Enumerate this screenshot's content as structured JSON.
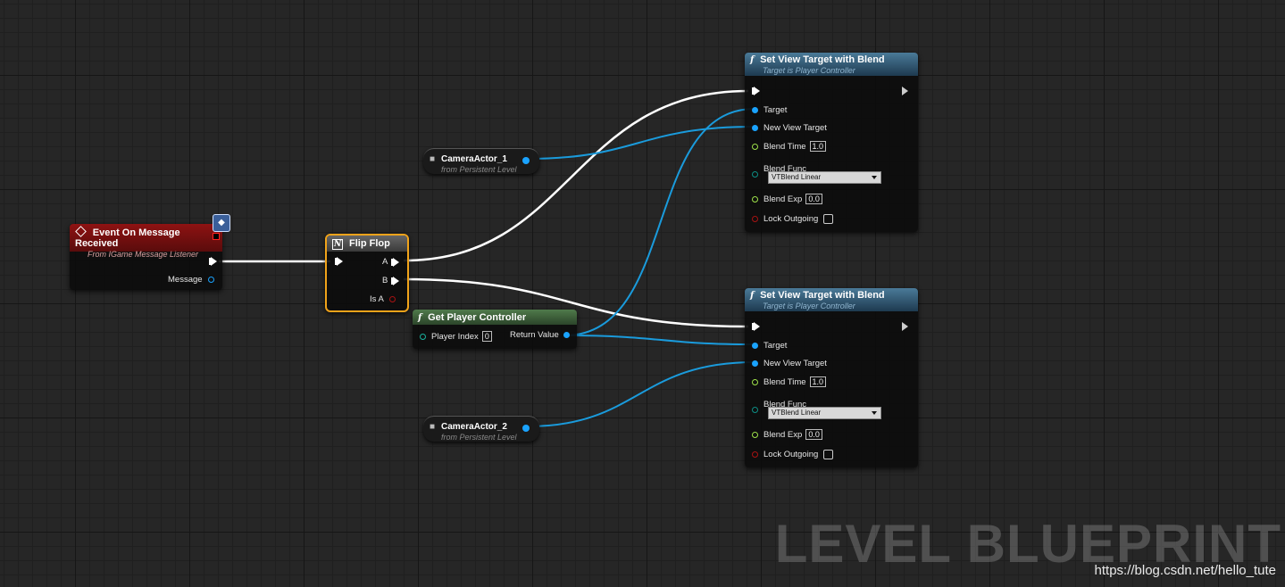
{
  "graph": {
    "watermark": "LEVEL BLUEPRINT",
    "credit": "https://blog.csdn.net/hello_tute"
  },
  "colors": {
    "event_header": "#8e1212",
    "function_header": "#2c5a78",
    "pure_function_header": "#3b5a3a",
    "flipflop_header": "#555555",
    "selection_outline": "#f0a31a",
    "exec_wire": "#ffffff",
    "object_wire": "#1a9bdc"
  },
  "nodes": {
    "event": {
      "title": "Event On Message Received",
      "subtitle": "From IGame Message Listener",
      "icon": "diamond-event-icon",
      "badge_icon": "interface-badge-icon",
      "message_label": "Message"
    },
    "flipflop": {
      "title": "Flip Flop",
      "icon": "macro-icon",
      "pin_a": "A",
      "pin_b": "B",
      "pin_isa": "Is A"
    },
    "camera1": {
      "title": "CameraActor_1",
      "subtitle": "from Persistent Level",
      "icon": "camera-icon"
    },
    "camera2": {
      "title": "CameraActor_2",
      "subtitle": "from Persistent Level",
      "icon": "camera-icon"
    },
    "getpc": {
      "title": "Get Player Controller",
      "icon": "function-icon",
      "player_index_label": "Player Index",
      "player_index_value": "0",
      "return_label": "Return Value"
    },
    "svt1": {
      "title": "Set View Target with Blend",
      "subtitle": "Target is Player Controller",
      "icon": "function-icon",
      "target": "Target",
      "new_view_target": "New View Target",
      "blend_time": "Blend Time",
      "blend_time_value": "1.0",
      "blend_func": "Blend Func",
      "blend_func_value": "VTBlend Linear",
      "blend_exp": "Blend Exp",
      "blend_exp_value": "0.0",
      "lock_outgoing": "Lock Outgoing"
    },
    "svt2": {
      "title": "Set View Target with Blend",
      "subtitle": "Target is Player Controller",
      "icon": "function-icon",
      "target": "Target",
      "new_view_target": "New View Target",
      "blend_time": "Blend Time",
      "blend_time_value": "1.0",
      "blend_func": "Blend Func",
      "blend_func_value": "VTBlend Linear",
      "blend_exp": "Blend Exp",
      "blend_exp_value": "0.0",
      "lock_outgoing": "Lock Outgoing"
    }
  }
}
